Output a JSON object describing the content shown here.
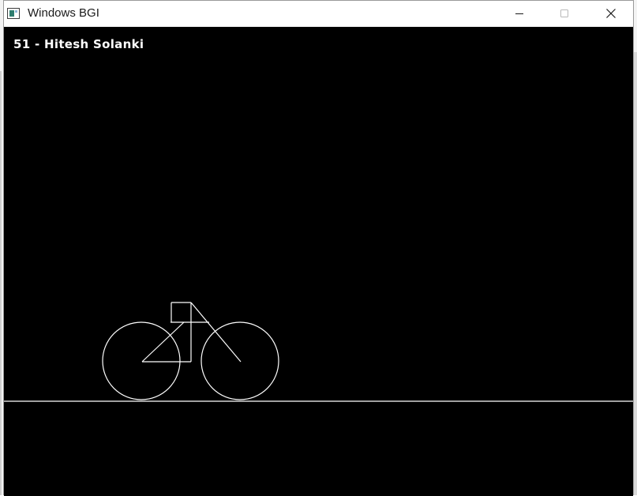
{
  "window": {
    "title": "Windows BGI",
    "controls": {
      "minimize_icon": "minimize-icon",
      "maximize_icon": "maximize-icon",
      "close_icon": "close-icon"
    }
  },
  "canvas": {
    "text": "51 - Hitesh Solanki",
    "background_color": "#000000",
    "stroke_color": "#ffffff",
    "drawing": "bicycle on ground line"
  }
}
